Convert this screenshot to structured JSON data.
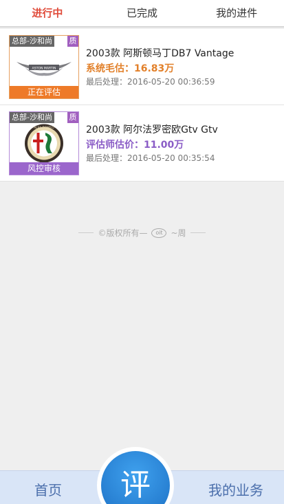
{
  "tabs": [
    {
      "label": "进行中",
      "active": true
    },
    {
      "label": "已完成",
      "active": false
    },
    {
      "label": "我的进件",
      "active": false
    }
  ],
  "items": [
    {
      "branch": "总部-沙和尚",
      "quality": "质",
      "status": "正在评估",
      "title": "2003款 阿斯顿马丁DB7 Vantage",
      "price_label": "系统毛估：16.83万",
      "time": "最后处理：2016-05-20 00:36:59",
      "logo_icon": "aston-martin-logo",
      "logo_text": "ASTON MARTIN",
      "accent_color": "#ee7a28"
    },
    {
      "branch": "总部-沙和尚",
      "quality": "质",
      "status": "风控审核",
      "title": "2003款 阿尔法罗密欧Gtv Gtv",
      "price_label": "评估师估价：11.00万",
      "time": "最后处理：2016-05-20 00:35:54",
      "logo_icon": "alfa-romeo-logo",
      "logo_text": "ALFA ROMEO",
      "accent_color": "#9b66cc"
    }
  ],
  "footer": {
    "copyright_before": "©版权所有—",
    "copyright_brand_icon": "brand-mark-icon",
    "copyright_brand": "oit",
    "copyright_after": "~周"
  },
  "bottom_nav": {
    "home": "首页",
    "evaluate": "评",
    "business": "我的业务"
  }
}
